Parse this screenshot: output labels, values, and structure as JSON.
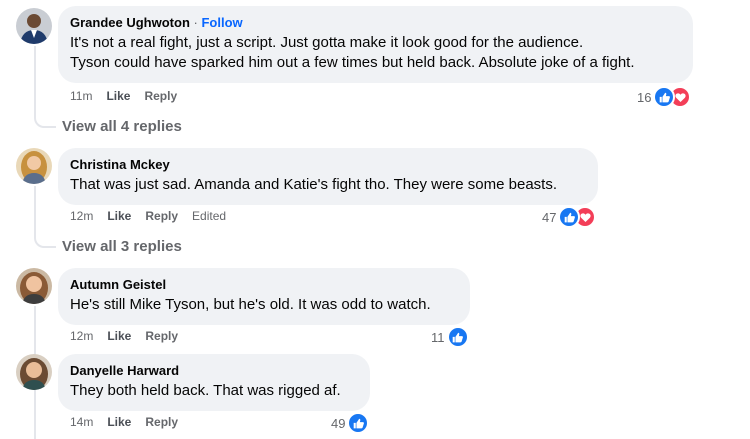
{
  "comments": [
    {
      "author": "Grandee Ughwoton",
      "follow_separator": "·",
      "follow": "Follow",
      "lines": [
        "It's not a real fight, just a script. Just gotta make it look good for the audience.",
        "Tyson could have sparked him out a few times but held back. Absolute joke of a fight."
      ],
      "time": "11m",
      "like": "Like",
      "reply": "Reply",
      "reaction_count": "16",
      "reactions": [
        "like-icon",
        "love-icon"
      ],
      "view_replies": "View all 4 replies"
    },
    {
      "author": "Christina Mckey",
      "lines": [
        "That was just sad. Amanda and Katie's fight tho. They were some beasts."
      ],
      "time": "12m",
      "like": "Like",
      "reply": "Reply",
      "edited": "Edited",
      "reaction_count": "47",
      "reactions": [
        "like-icon",
        "love-icon"
      ],
      "view_replies": "View all 3 replies"
    },
    {
      "author": "Autumn Geistel",
      "lines": [
        "He's still Mike Tyson, but he's old. It was odd to watch."
      ],
      "time": "12m",
      "like": "Like",
      "reply": "Reply",
      "reaction_count": "11",
      "reactions": [
        "like-icon"
      ]
    },
    {
      "author": "Danyelle Harward",
      "lines": [
        "They both held back. That was rigged af."
      ],
      "time": "14m",
      "like": "Like",
      "reply": "Reply",
      "reaction_count": "49",
      "reactions": [
        "like-icon"
      ]
    }
  ],
  "colors": {
    "bubble": "#f0f2f5",
    "link": "#0866ff",
    "muted": "#65676b",
    "like": "#1877f2",
    "love": "#f33e58"
  }
}
